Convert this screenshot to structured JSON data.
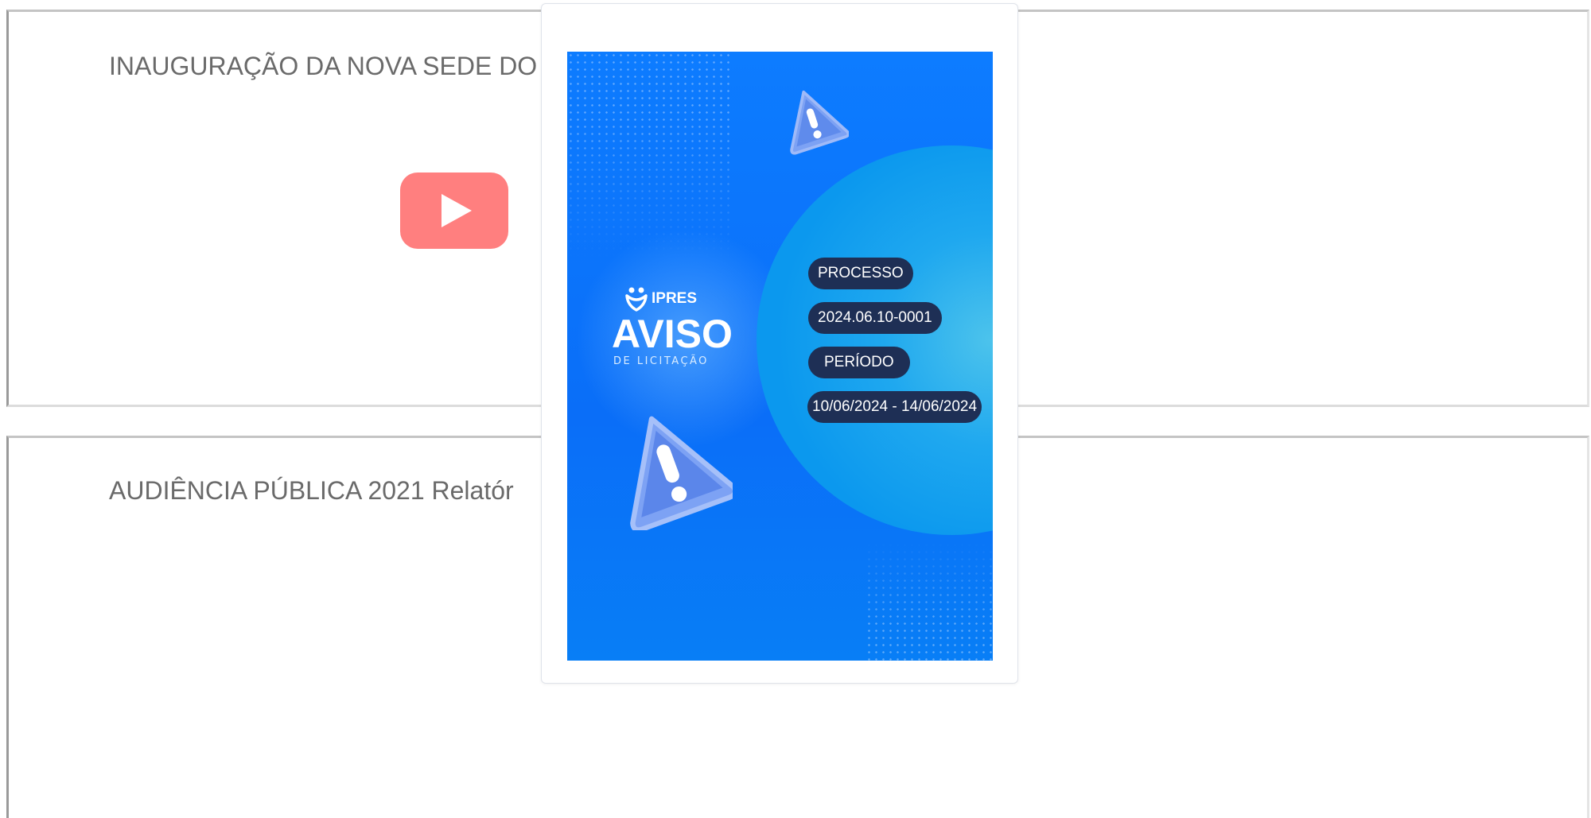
{
  "videos": [
    {
      "title": "INAUGURAÇÃO DA NOVA SEDE DO",
      "play_icon": "youtube-play-icon"
    },
    {
      "title": "AUDIÊNCIA PÚBLICA 2021 Relatór"
    }
  ],
  "popup": {
    "brand": "IPRES",
    "title": "AVISO",
    "subtitle": "DE LICITAÇÃO",
    "labels": {
      "process": "PROCESSO",
      "process_number": "2024.06.10-0001",
      "period": "PERÍODO",
      "period_range": "10/06/2024 - 14/06/2024"
    },
    "icons": [
      "warning-triangle-icon",
      "ipres-logo-icon"
    ]
  },
  "colors": {
    "poster_blue": "#0d7cff",
    "circle_cyan": "#1fa8ef",
    "pill_navy": "#1e2f55",
    "youtube_red": "#ff7f7f",
    "title_gray": "#6a6a6a"
  }
}
